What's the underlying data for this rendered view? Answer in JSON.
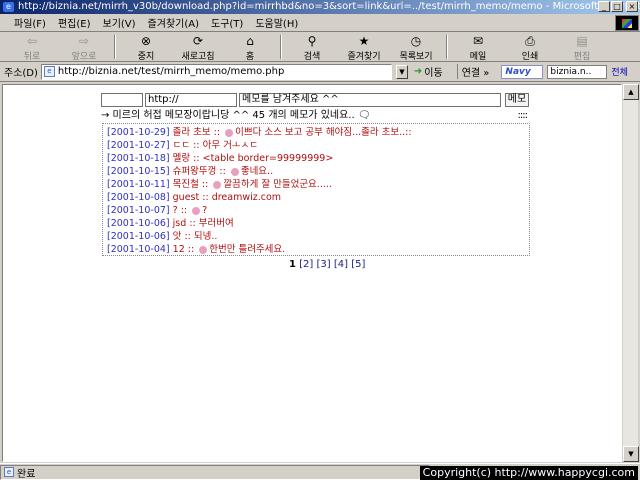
{
  "window": {
    "title": "http://biznia.net/mirrh_v30b/download.php?id=mirrhbd&no=3&sort=link&url=../test/mirrh_memo/memo - Microsoft Internet Explorer",
    "min_label": "_",
    "max_label": "□",
    "close_label": "×"
  },
  "menu": [
    "파일(F)",
    "편집(E)",
    "보기(V)",
    "즐겨찾기(A)",
    "도구(T)",
    "도움말(H)"
  ],
  "toolbar": [
    {
      "label": "뒤로",
      "icon": "back-arrow-icon",
      "glyph": "⇦",
      "enabled": false
    },
    {
      "label": "앞으로",
      "icon": "forward-arrow-icon",
      "glyph": "⇨",
      "enabled": false
    },
    {
      "label": "중지",
      "icon": "stop-icon",
      "glyph": "⊗",
      "enabled": true
    },
    {
      "label": "새로고침",
      "icon": "refresh-icon",
      "glyph": "⟳",
      "enabled": true
    },
    {
      "label": "홈",
      "icon": "home-icon",
      "glyph": "⌂",
      "enabled": true
    },
    {
      "label": "검색",
      "icon": "search-icon",
      "glyph": "⚲",
      "enabled": true
    },
    {
      "label": "즐겨찾기",
      "icon": "favorites-icon",
      "glyph": "★",
      "enabled": true
    },
    {
      "label": "목록보기",
      "icon": "history-icon",
      "glyph": "◷",
      "enabled": true
    },
    {
      "label": "메일",
      "icon": "mail-icon",
      "glyph": "✉",
      "enabled": true
    },
    {
      "label": "인쇄",
      "icon": "print-icon",
      "glyph": "⎙",
      "enabled": true
    },
    {
      "label": "편집",
      "icon": "edit-icon",
      "glyph": "▤",
      "enabled": false
    }
  ],
  "address": {
    "label": "주소(D)",
    "url": "http://biznia.net/test/mirrh_memo/memo.php",
    "go_label": "이동",
    "links_label": "연결 »",
    "search_brand": "Navy",
    "search_value": "biznia.n..",
    "search_all": "전체"
  },
  "memo_form": {
    "name_value": "",
    "url_value": "http://",
    "message_value": "메모를 남겨주세요 ^^",
    "submit_label": "메모"
  },
  "intro_text": "→ 미르의 허접 메모장이랍니당 ^^ 45 개의 메모가 있네요.. 🗨",
  "intro_dots": "::::",
  "memos": [
    {
      "date": "[2001-10-29]",
      "name": "졸라 초보",
      "message": "이쁘다 소스 보고 공부 해야짐...졸라 초보..::",
      "emote": true
    },
    {
      "date": "[2001-10-27]",
      "name": "ㄷㄷ",
      "message": "아무 거ㅗㅅㄷ",
      "emote": false
    },
    {
      "date": "[2001-10-18]",
      "name": "멜랑",
      "message": "<table border=99999999>",
      "emote": false
    },
    {
      "date": "[2001-10-15]",
      "name": "슈퍼왕뚜껑",
      "message": "좋네요..",
      "emote": true
    },
    {
      "date": "[2001-10-11]",
      "name": "목진철",
      "message": "깔끔하게 잘 만들었군요.....",
      "emote": true
    },
    {
      "date": "[2001-10-08]",
      "name": "guest",
      "message": "dreamwiz.com",
      "emote": false
    },
    {
      "date": "[2001-10-07]",
      "name": "?",
      "message": "?",
      "emote": true
    },
    {
      "date": "[2001-10-06]",
      "name": "jsd",
      "message": "부러버여",
      "emote": false
    },
    {
      "date": "[2001-10-06]",
      "name": "앗",
      "message": "되넹..",
      "emote": false
    },
    {
      "date": "[2001-10-04]",
      "name": "12",
      "message": "한번만 틀려주세요.",
      "emote": true
    }
  ],
  "memo_separator": "::",
  "pager": {
    "current": "1",
    "pages": [
      "[2]",
      "[3]",
      "[4]",
      "[5]"
    ]
  },
  "status": {
    "text": "완료"
  },
  "copyright": "Copyright(c) http://www.happycgi.com"
}
